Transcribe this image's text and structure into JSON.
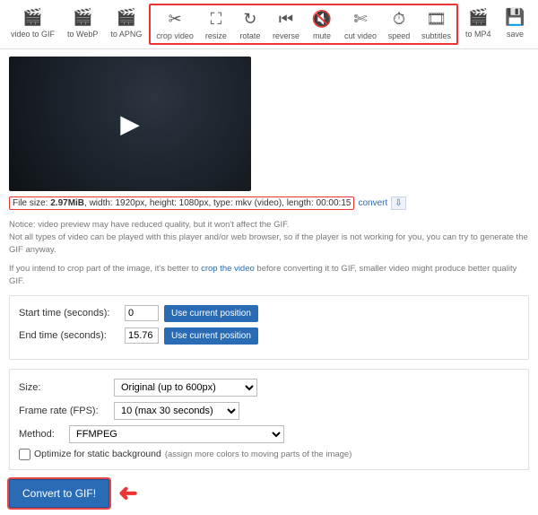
{
  "toolbar": {
    "items": [
      {
        "label": "video to GIF",
        "icon": "🎬"
      },
      {
        "label": "to WebP",
        "icon": "🎬"
      },
      {
        "label": "to APNG",
        "icon": "🎬"
      },
      {
        "label": "crop video",
        "icon": "✂"
      },
      {
        "label": "resize",
        "icon": "⛶"
      },
      {
        "label": "rotate",
        "icon": "↻"
      },
      {
        "label": "reverse",
        "icon": "⏮"
      },
      {
        "label": "mute",
        "icon": "🔇"
      },
      {
        "label": "cut video",
        "icon": "✄"
      },
      {
        "label": "speed",
        "icon": "⏱"
      },
      {
        "label": "subtitles",
        "icon": "🎞"
      },
      {
        "label": "to MP4",
        "icon": "🎬"
      },
      {
        "label": "save",
        "icon": "💾"
      }
    ]
  },
  "info": {
    "size_label": "File size:",
    "size_value": "2.97MiB",
    "rest": ", width: 1920px, height: 1080px, type: mkv (video), length: 00:00:15",
    "convert": "convert",
    "dl": "⇩"
  },
  "notes": {
    "n1": "Notice: video preview may have reduced quality, but it won't affect the GIF.",
    "n2": "Not all types of video can be played with this player and/or web browser, so if the player is not working for you, you can try to generate the GIF anyway.",
    "n3a": "If you intend to crop part of the image, it's better to ",
    "n3link": "crop the video",
    "n3b": " before converting it to GIF, smaller video might produce better quality GIF."
  },
  "time": {
    "start_label": "Start time (seconds):",
    "end_label": "End time (seconds):",
    "start_val": "0",
    "end_val": "15.76",
    "use_btn": "Use current position"
  },
  "opts": {
    "size_label": "Size:",
    "size_val": "Original (up to 600px)",
    "fps_label": "Frame rate (FPS):",
    "fps_val": "10 (max 30 seconds)",
    "method_label": "Method:",
    "method_val": "FFMPEG",
    "chk_label": "Optimize for static background",
    "chk_hint": "(assign more colors to moving parts of the image)"
  },
  "convert_btn": "Convert to GIF!"
}
